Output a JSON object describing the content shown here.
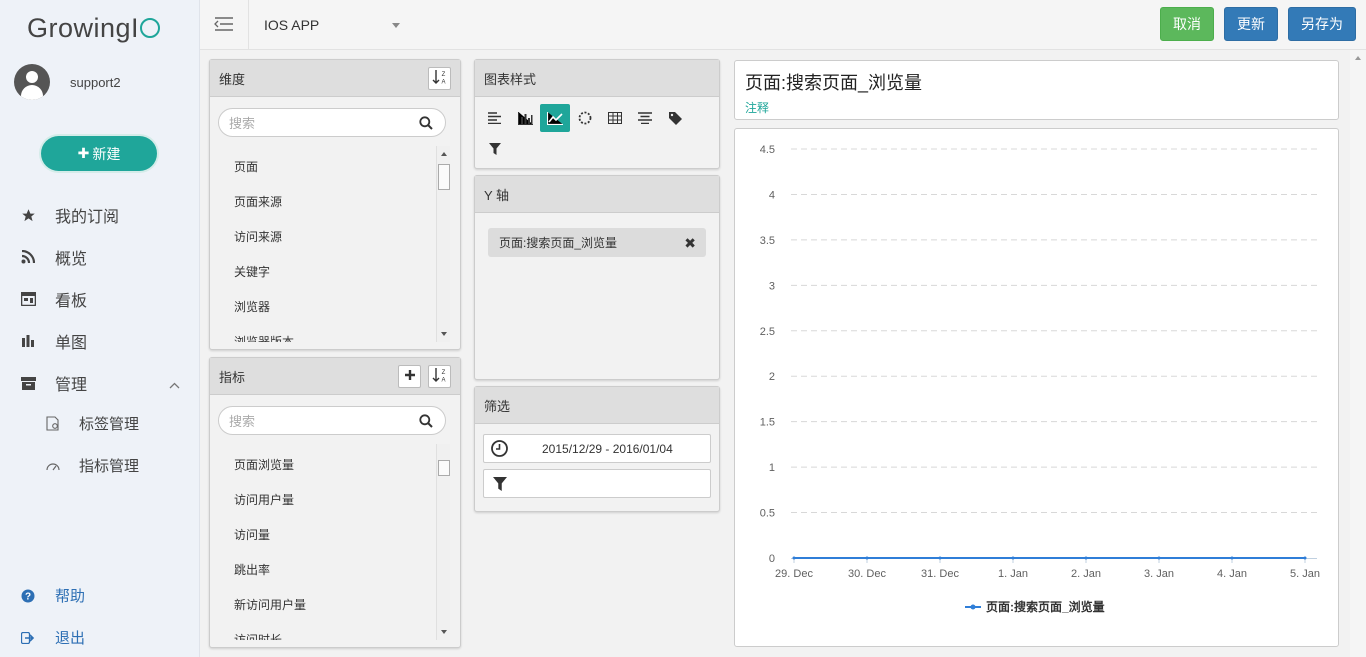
{
  "sidebar": {
    "logo": {
      "prefix": "Growing",
      "mid": "I",
      "suffix": "O"
    },
    "username": "support2",
    "new_button": "新建",
    "nav": [
      {
        "label": "我的订阅",
        "icon": "star-icon"
      },
      {
        "label": "概览",
        "icon": "rss-icon"
      },
      {
        "label": "看板",
        "icon": "dashboard-icon"
      },
      {
        "label": "单图",
        "icon": "bar-chart-icon"
      },
      {
        "label": "管理",
        "icon": "inbox-icon"
      }
    ],
    "sub_nav": [
      {
        "label": "标签管理",
        "icon": "tag-file-icon"
      },
      {
        "label": "指标管理",
        "icon": "gauge-icon"
      }
    ],
    "bottom": [
      {
        "label": "帮助",
        "icon": "help-icon"
      },
      {
        "label": "退出",
        "icon": "logout-icon"
      }
    ]
  },
  "topbar": {
    "app_name": "IOS APP",
    "cancel": "取消",
    "update": "更新",
    "save_as": "另存为"
  },
  "dimensions": {
    "title": "维度",
    "search_placeholder": "搜索",
    "items": [
      "页面",
      "页面来源",
      "访问来源",
      "关键字",
      "浏览器",
      "浏览器版本"
    ]
  },
  "metrics": {
    "title": "指标",
    "search_placeholder": "搜索",
    "items": [
      "页面浏览量",
      "访问用户量",
      "访问量",
      "跳出率",
      "新访问用户量",
      "访问时长"
    ]
  },
  "chart_style": {
    "title": "图表样式",
    "icons": [
      "bar-horizontal-icon",
      "bar-vertical-icon",
      "line-chart-icon",
      "donut-chart-icon",
      "table-icon",
      "funnel-bars-icon",
      "tag-icon",
      "filter-icon"
    ],
    "active": "line-chart-icon"
  },
  "y_axis": {
    "title": "Y 轴",
    "tag": "页面:搜索页面_浏览量"
  },
  "filter": {
    "title": "筛选",
    "date_range": "2015/12/29 - 2016/01/04"
  },
  "chart_header": {
    "title": "页面:搜索页面_浏览量",
    "annotation": "注释"
  },
  "chart_data": {
    "type": "line",
    "categories": [
      "29. Dec",
      "30. Dec",
      "31. Dec",
      "1. Jan",
      "2. Jan",
      "3. Jan",
      "4. Jan",
      "5. Jan"
    ],
    "y_ticks": [
      "0",
      "0.5",
      "1",
      "1.5",
      "2",
      "2.5",
      "3",
      "3.5",
      "4",
      "4.5"
    ],
    "ylim": [
      0,
      4.5
    ],
    "series": [
      {
        "name": "页面:搜索页面_浏览量",
        "values": [
          0,
          0,
          0,
          0,
          0,
          0,
          0,
          0
        ],
        "color": "#2f7ed8"
      }
    ],
    "grid": true,
    "legend": "bottom-center"
  }
}
